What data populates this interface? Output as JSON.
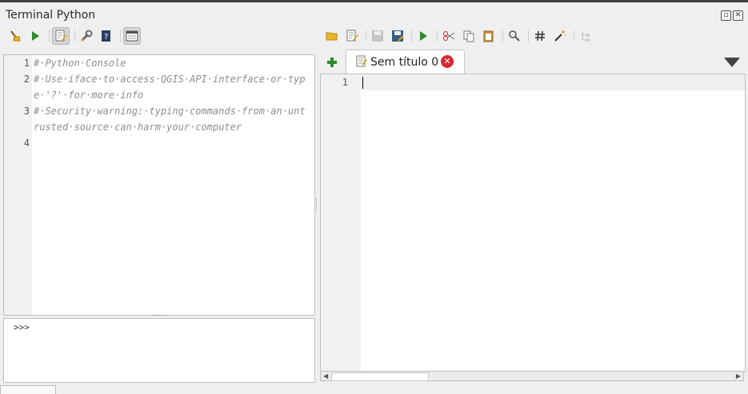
{
  "panel": {
    "title": "Terminal Python",
    "float_icon": "float-icon",
    "close_icon": "close-icon"
  },
  "console_toolbar": [
    {
      "name": "clear-console",
      "icon": "broom-icon"
    },
    {
      "name": "run-command",
      "icon": "play-icon"
    },
    {
      "name": "show-editor",
      "icon": "editor-icon",
      "active": true
    },
    {
      "name": "options",
      "icon": "wrench-icon"
    },
    {
      "name": "help",
      "icon": "help-book-icon"
    },
    {
      "name": "dock-toggle",
      "icon": "window-icon",
      "active": true
    }
  ],
  "console": {
    "lines": [
      {
        "num": "1",
        "text": "#·Python·Console"
      },
      {
        "num": "2",
        "text": "#·Use·iface·to·access·QGIS·API·interface·or·typ",
        "cont": "e·'?'·for·more·info"
      },
      {
        "num": "3",
        "text": "#·Security·warning:·typing·commands·from·an·unt",
        "cont": "rusted·source·can·harm·your·computer"
      },
      {
        "num": "4",
        "text": ""
      }
    ],
    "prompt": ">>>"
  },
  "editor_toolbar": [
    {
      "name": "open-script",
      "icon": "folder-open-icon"
    },
    {
      "name": "open-in-editor",
      "icon": "edit-script-icon"
    },
    {
      "name": "save",
      "icon": "save-icon",
      "disabled": true
    },
    {
      "name": "save-as",
      "icon": "save-as-icon"
    },
    {
      "name": "run-script",
      "icon": "play-icon"
    },
    {
      "name": "cut",
      "icon": "scissors-icon"
    },
    {
      "name": "copy",
      "icon": "copy-icon"
    },
    {
      "name": "paste",
      "icon": "paste-icon"
    },
    {
      "name": "find",
      "icon": "search-icon"
    },
    {
      "name": "comment",
      "icon": "hash-icon"
    },
    {
      "name": "format",
      "icon": "magic-wand-icon"
    },
    {
      "name": "object-inspector",
      "icon": "tree-icon",
      "disabled": true
    }
  ],
  "editor": {
    "tab_label": "Sem título 0",
    "line_number": "1",
    "colors": {
      "close": "#d7262e",
      "play": "#2e8b2e"
    }
  }
}
